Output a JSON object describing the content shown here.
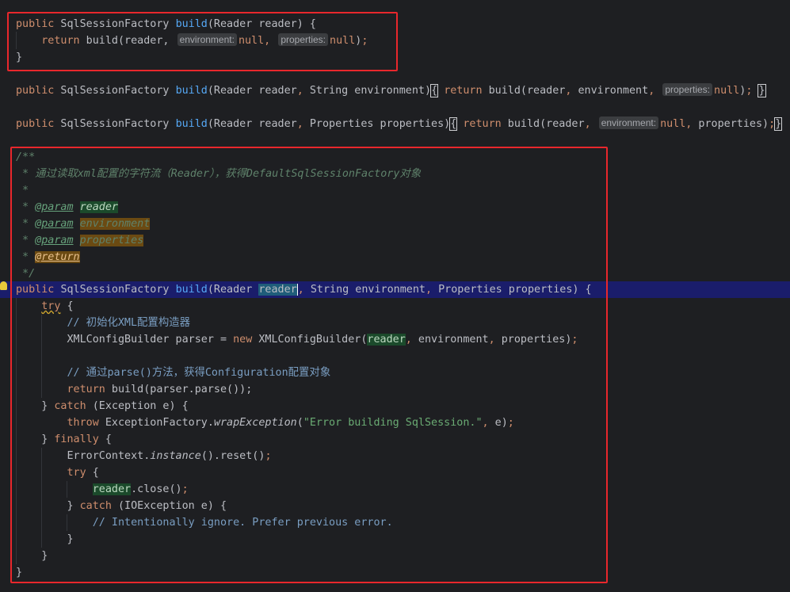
{
  "top_method": {
    "sig": "public SqlSessionFactory build(Reader reader) {",
    "body_return": "return build(reader,",
    "hint_env": "environment:",
    "hint_props": "properties:",
    "null1": "null,",
    "null2": "null);",
    "close": "}"
  },
  "folded": [
    {
      "sig": "public SqlSessionFactory build(Reader reader, String environment)",
      "body": "return build(reader, environment,",
      "hint": "properties:",
      "tail": "null);"
    },
    {
      "sig": "public SqlSessionFactory build(Reader reader, Properties properties)",
      "body": "return build(reader,",
      "hint": "environment:",
      "tail": "null, properties);"
    }
  ],
  "javadoc": {
    "open": "/**",
    "desc": " * 通过读取xml配置的字符流（Reader），获得DefaultSqlSessionFactory对象",
    "blank": " *",
    "params": [
      {
        "tag": "@param",
        "name": "reader"
      },
      {
        "tag": "@param",
        "name": "environment"
      },
      {
        "tag": "@param",
        "name": "properties"
      }
    ],
    "return_tag": "@return",
    "close": " */"
  },
  "main_method": {
    "sig_public": "public",
    "sig_type": "SqlSessionFactory",
    "sig_name": "build",
    "sig_param1_type": "(Reader ",
    "sig_param1_name": "reader",
    "sig_rest": ", String environment, Properties properties) {",
    "try": "try",
    "comment1": "// 初始化XML配置构造器",
    "parser_decl": "XMLConfigBuilder parser = ",
    "new_kw": "new",
    "parser_ctor": " XMLConfigBuilder(",
    "parser_arg1": "reader",
    "parser_args_rest": ", environment, properties);",
    "comment2": "// 通过parse()方法，获得Configuration配置对象",
    "return_kw": "return",
    "return_expr": " build(parser.parse());",
    "catch_kw": "catch",
    "catch_rest": " (Exception e) {",
    "throw_kw": "throw",
    "throw_cls": " ExceptionFactory.",
    "throw_method": "wrapException",
    "throw_str": "\"Error building SqlSession.\"",
    "throw_tail": ", e);",
    "finally_kw": "finally",
    "error_ctx": "ErrorContext.",
    "error_inst": "instance",
    "error_tail": "().reset();",
    "inner_try": "try",
    "reader_close_var": "reader",
    "reader_close_tail": ".close();",
    "inner_catch": "catch",
    "inner_catch_rest": " (IOException e) {",
    "ignore_comment": "// Intentionally ignore. Prefer previous error."
  },
  "colors": {
    "background": "#1e1f22",
    "keyword": "#cf8e6d",
    "function": "#56a8f5",
    "highlight_box": "#e8272c"
  }
}
